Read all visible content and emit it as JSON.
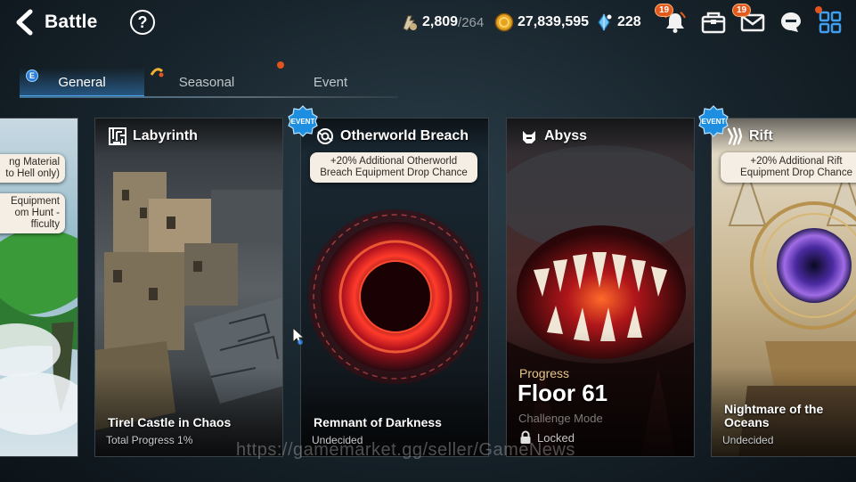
{
  "header": {
    "back_label": "Battle",
    "help_symbol": "?",
    "stamina": {
      "current": "2,809",
      "max": "/264",
      "icon": "stamina-icon"
    },
    "gold": {
      "amount": "27,839,595",
      "icon": "gold-coin-icon"
    },
    "skystone": {
      "amount": "228",
      "icon": "skystone-icon"
    },
    "notifications_badge": "19",
    "mail_badge": "19"
  },
  "tabs": [
    {
      "label": "General",
      "active": true,
      "badge": "E"
    },
    {
      "label": "Seasonal",
      "active": false
    },
    {
      "label": "Event",
      "active": false
    }
  ],
  "cards": {
    "partial_left": {
      "bonus1_line1": "ng Material",
      "bonus1_line2": "to Hell only)",
      "bonus2_line1": "Equipment",
      "bonus2_line2": "om Hunt -",
      "bonus2_line3": "fficulty"
    },
    "labyrinth": {
      "title": "Labyrinth",
      "name": "Tirel Castle in Chaos",
      "sub": "Total Progress 1%"
    },
    "otherworld": {
      "title": "Otherworld Breach",
      "event_badge": "EVENT",
      "bonus": "+20% Additional Otherworld Breach Equipment Drop Chance",
      "name": "Remnant of Darkness",
      "sub": "Undecided"
    },
    "abyss": {
      "title": "Abyss",
      "progress_label": "Progress",
      "floor": "Floor 61",
      "mode": "Challenge Mode",
      "locked": "Locked"
    },
    "rift": {
      "title": "Rift",
      "event_badge": "EVENT",
      "bonus": "+20% Additional Rift Equipment Drop Chance",
      "name": "Nightmare of the Oceans",
      "sub": "Undecided"
    }
  },
  "watermark": "https://gamemarket.gg/seller/GameNews",
  "colors": {
    "accent_blue": "#4ba3ee",
    "badge_orange": "#e25a1e",
    "event_badge_blue": "#1e8fe0",
    "bonus_bg": "#f4eee4"
  }
}
